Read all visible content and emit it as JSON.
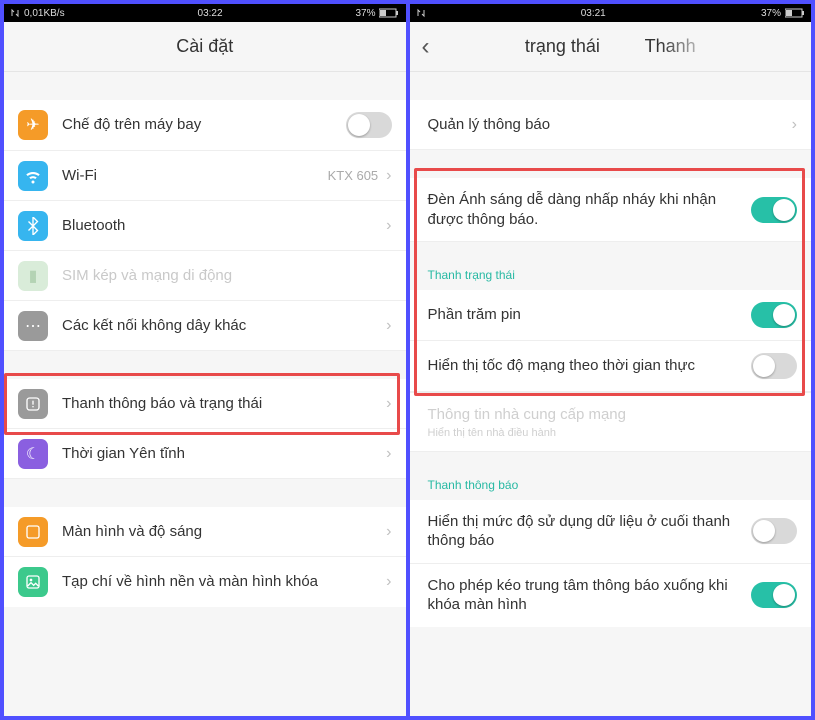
{
  "left": {
    "status": {
      "netspeed": "0,01KB/s",
      "time": "03:22",
      "battery": "37%"
    },
    "title": "Cài đặt",
    "rows": {
      "airplane": {
        "label": "Chế độ trên máy bay",
        "toggle": false
      },
      "wifi": {
        "label": "Wi-Fi",
        "value": "KTX 605"
      },
      "bt": {
        "label": "Bluetooth"
      },
      "sim": {
        "label": "SIM kép và mạng di động"
      },
      "other": {
        "label": "Các kết nối không dây khác"
      },
      "notif": {
        "label": "Thanh thông báo và trạng thái"
      },
      "dnd": {
        "label": "Thời gian Yên tĩnh"
      },
      "display": {
        "label": "Màn hình và độ sáng"
      },
      "wallpaper": {
        "label": "Tạp chí về hình nền và màn hình khóa"
      }
    }
  },
  "right": {
    "status": {
      "netspeed": "",
      "time": "03:21",
      "battery": "37%"
    },
    "title_part1": "trạng thái",
    "title_part2": "Thanh",
    "rows": {
      "manage": {
        "label": "Quản lý thông báo"
      },
      "blink": {
        "label": "Đèn Ánh sáng dễ dàng nhấp nháy khi nhận được thông báo.",
        "toggle": true
      },
      "hdr1": "Thanh trạng thái",
      "battery": {
        "label": "Phần trăm pin",
        "toggle": true
      },
      "netspeed": {
        "label": "Hiển thị tốc độ mạng theo thời gian thực",
        "toggle": false
      },
      "carrier": {
        "label": "Thông tin nhà cung cấp mạng",
        "sub": "Hiển thị tên nhà điều hành"
      },
      "hdr2": "Thanh thông báo",
      "datausage": {
        "label": "Hiển thị mức độ sử dụng dữ liệu ở cuối thanh thông báo",
        "toggle": false
      },
      "pulldown": {
        "label": "Cho phép kéo trung tâm thông báo xuống khi khóa màn hình",
        "toggle": true
      }
    }
  }
}
